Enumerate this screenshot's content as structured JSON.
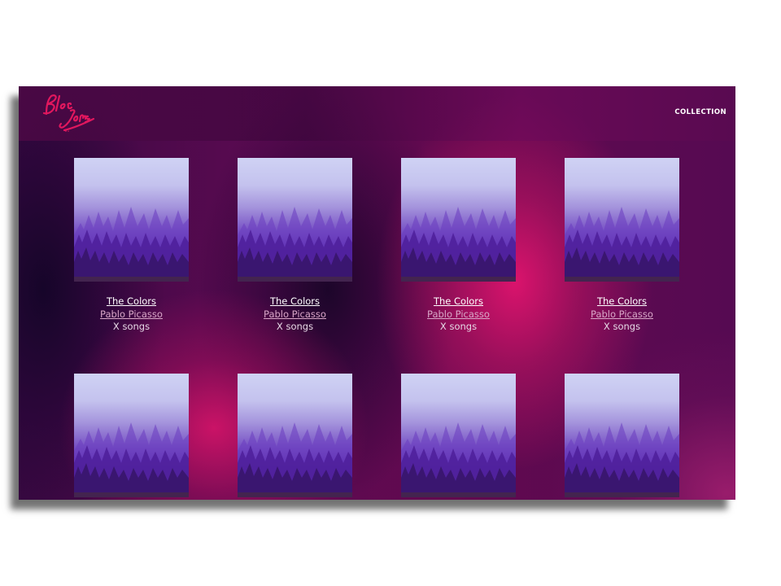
{
  "app": {
    "logo_text": "Bloc Jams",
    "nav": {
      "collection_label": "COLLECTION"
    }
  },
  "albums": [
    {
      "title": "The Colors ",
      "artist": "Pablo Picasso ",
      "song_count": "X songs"
    },
    {
      "title": "The Colors ",
      "artist": "Pablo Picasso ",
      "song_count": "X songs"
    },
    {
      "title": "The Colors ",
      "artist": "Pablo Picasso ",
      "song_count": "X songs"
    },
    {
      "title": "The Colors ",
      "artist": "Pablo Picasso ",
      "song_count": "X songs"
    },
    {
      "title": "",
      "artist": "",
      "song_count": ""
    },
    {
      "title": "",
      "artist": "",
      "song_count": ""
    },
    {
      "title": "",
      "artist": "",
      "song_count": ""
    },
    {
      "title": "",
      "artist": "",
      "song_count": ""
    }
  ],
  "colors": {
    "logo": "#e0175e",
    "nav_text": "#ffffff",
    "album_title": "#ffffff",
    "album_artist": "#d9a7c8",
    "album_songs": "#e6d9e6"
  }
}
